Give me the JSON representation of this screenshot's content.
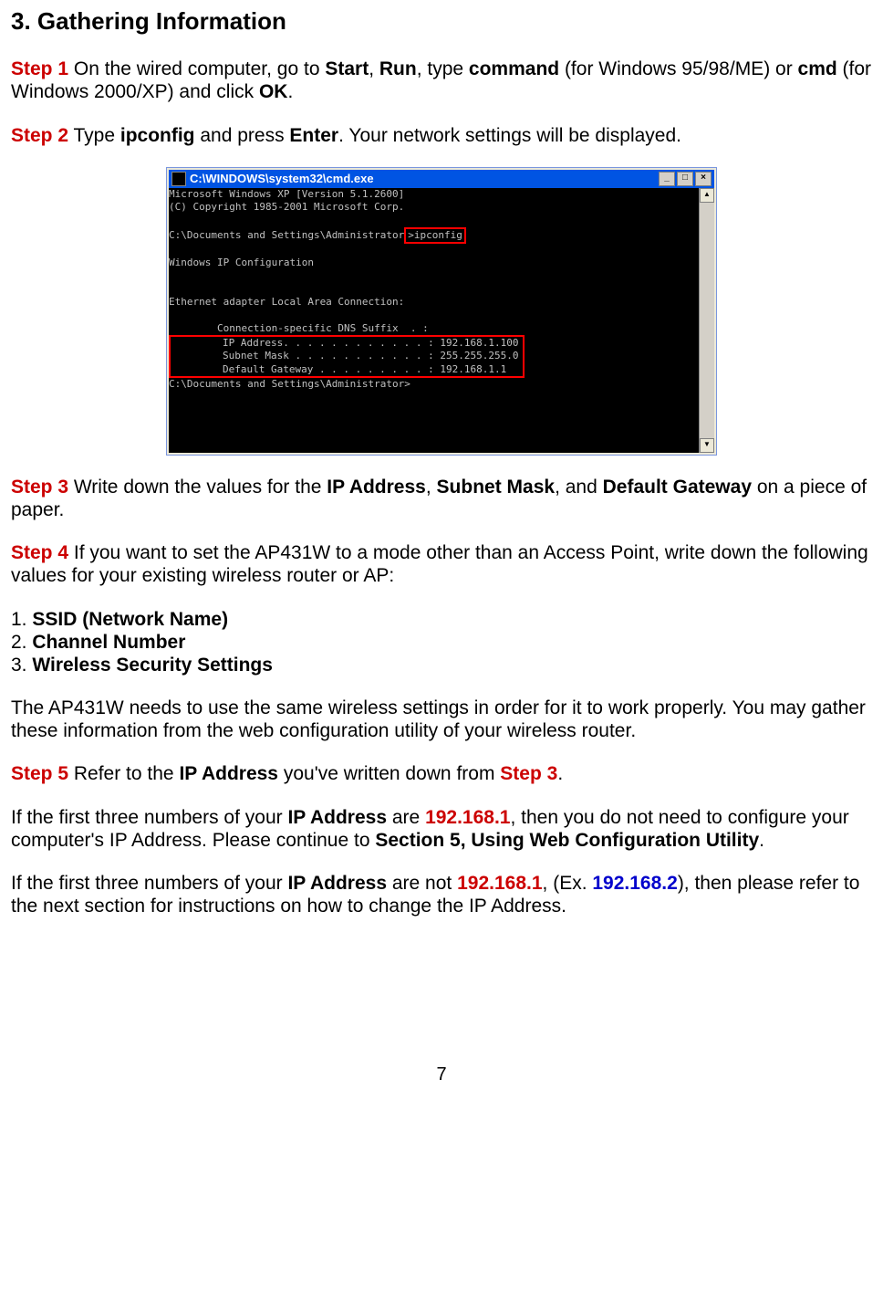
{
  "heading": "3. Gathering Information",
  "step1": {
    "label": "Step 1",
    "text1": " On the wired computer, go to ",
    "b1": "Start",
    "c1": ", ",
    "b2": "Run",
    "c2": ", type ",
    "b3": "command",
    "c3": " (for Windows 95/98/ME) or ",
    "b4": "cmd",
    "c4": " (for Windows 2000/XP) and click ",
    "b5": "OK",
    "c5": "."
  },
  "step2": {
    "label": "Step 2",
    "t1": " Type ",
    "b1": "ipconfig",
    "t2": " and press ",
    "b2": "Enter",
    "t3": ". Your network settings will be displayed."
  },
  "cmd": {
    "title": "C:\\WINDOWS\\system32\\cmd.exe",
    "min": "_",
    "max": "□",
    "close": "×",
    "line1": "Microsoft Windows XP [Version 5.1.2600]",
    "line2": "(C) Copyright 1985-2001 Microsoft Corp.",
    "prompt1a": "C:\\Documents and Settings\\Administrator",
    "prompt1b": ">ipconfig",
    "line4": "Windows IP Configuration",
    "line5": "Ethernet adapter Local Area Connection:",
    "line6": "        Connection-specific DNS Suffix  . :",
    "hl1": "        IP Address. . . . . . . . . . . . : 192.168.1.100",
    "hl2": "        Subnet Mask . . . . . . . . . . . : 255.255.255.0",
    "hl3": "        Default Gateway . . . . . . . . . : 192.168.1.1",
    "prompt2": "C:\\Documents and Settings\\Administrator>",
    "up": "▲",
    "down": "▼"
  },
  "step3": {
    "label": "Step 3",
    "t1": " Write down the values for the ",
    "b1": "IP Address",
    "c1": ", ",
    "b2": "Subnet Mask",
    "c2": ", and ",
    "b3": "Default Gateway",
    "t2": " on a piece of paper."
  },
  "step4": {
    "label": "Step 4",
    "t1": " If you want to set the AP431W to a mode other than an Access Point, write down the following values for your existing wireless router or AP:"
  },
  "list": {
    "n1": "1. ",
    "b1": "SSID (Network Name)",
    "n2": "2. ",
    "b2": "Channel Number",
    "n3": "3. ",
    "b3": "Wireless Security Settings"
  },
  "para_ap": "The AP431W needs to use the same wireless settings in order for it to work properly. You may gather these information from the web configuration utility of your wireless router.",
  "step5": {
    "label": "Step 5",
    "t1": " Refer to the ",
    "b1": "IP Address",
    "t2": " you've written down from ",
    "r1": "Step 3",
    "t3": "."
  },
  "para_if1": {
    "t1": "If the first three numbers of your ",
    "b1": "IP Address",
    "t2": " are ",
    "r1": "192.168.1",
    "t3": ", then you do not need to configure your computer's IP Address. Please continue to ",
    "b2": "Section 5, Using Web Configuration Utility",
    "t4": "."
  },
  "para_if2": {
    "t1": "If the first three numbers of your ",
    "b1": "IP Address",
    "t2": " are not ",
    "r1": "192.168.1",
    "t3": ", (Ex. ",
    "bl1": "192.168.2",
    "t4": "), then please refer to the next section for instructions on how to change the IP Address."
  },
  "pagenum": "7"
}
